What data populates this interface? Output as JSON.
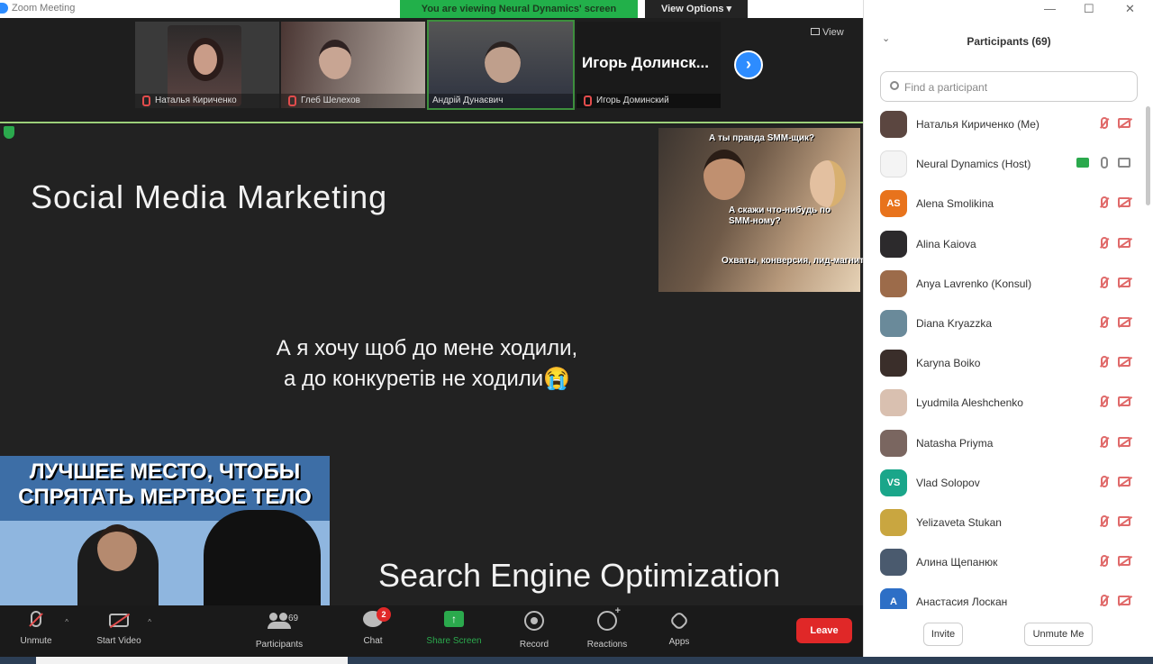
{
  "window": {
    "title": "Zoom Meeting",
    "viewing_banner": "You are viewing Neural Dynamics' screen",
    "view_options": "View Options ▾"
  },
  "video_strip": {
    "view_label": "View",
    "tiles": [
      {
        "name": "Наталья Кириченко"
      },
      {
        "name": "Глеб Шелехов"
      },
      {
        "name": "Андрій Дунаєвич"
      },
      {
        "name": "Игорь Доминский",
        "big_name": "Игорь Долинск..."
      }
    ]
  },
  "shared_screen": {
    "slide_title": "Social Media Marketing",
    "meme_top": {
      "caption_1": "А ты правда SMM-щик?",
      "caption_2": "А скажи что-нибудь по SMM-ному?",
      "caption_3": "Охваты, конверсия, лид-магнит"
    },
    "center_text_line1": "А я хочу щоб до мене ходили,",
    "center_text_line2": "а до конкуретів не ходили",
    "center_emoji": "😭",
    "meme_bottom_caption": "ЛУЧШЕЕ МЕСТО, ЧТОБЫ СПРЯТАТЬ МЕРТВОЕ ТЕЛО",
    "seo_text": "Search Engine Optimization"
  },
  "toolbar": {
    "unmute": "Unmute",
    "start_video": "Start Video",
    "participants": "Participants",
    "participants_count": "69",
    "chat": "Chat",
    "chat_badge": "2",
    "share_screen": "Share Screen",
    "record": "Record",
    "reactions": "Reactions",
    "apps": "Apps",
    "leave": "Leave"
  },
  "panel": {
    "title": "Participants (69)",
    "search_placeholder": "Find a participant",
    "participants": [
      {
        "name": "Наталья Кириченко (Me)",
        "avatar": "photo",
        "color": "#5b4640"
      },
      {
        "name": "Neural Dynamics (Host)",
        "avatar": "logo",
        "color": "#f4f4f4",
        "host": true
      },
      {
        "name": "Alena Smolikina",
        "avatar": "AS",
        "color": "#e8731c"
      },
      {
        "name": "Alina Kaiova",
        "avatar": "photo",
        "color": "#2c2a2c"
      },
      {
        "name": "Anya Lavrenko (Konsul)",
        "avatar": "photo",
        "color": "#9c6b4a"
      },
      {
        "name": "Diana Kryazzka",
        "avatar": "photo",
        "color": "#6a8a9a"
      },
      {
        "name": "Karyna Boiko",
        "avatar": "photo",
        "color": "#3a2e2a"
      },
      {
        "name": "Lyudmila Aleshchenko",
        "avatar": "photo",
        "color": "#d9c0b0"
      },
      {
        "name": "Natasha Priyma",
        "avatar": "photo",
        "color": "#7a6660"
      },
      {
        "name": "Vlad Solopov",
        "avatar": "VS",
        "color": "#1aa68a"
      },
      {
        "name": "Yelizaveta Stukan",
        "avatar": "photo",
        "color": "#c9a640"
      },
      {
        "name": "Алина Щепанюк",
        "avatar": "photo",
        "color": "#4a5a6e"
      },
      {
        "name": "Анастасия Лоскан",
        "avatar": "A",
        "color": "#2d6fc6"
      }
    ],
    "invite": "Invite",
    "unmute_me": "Unmute Me"
  }
}
